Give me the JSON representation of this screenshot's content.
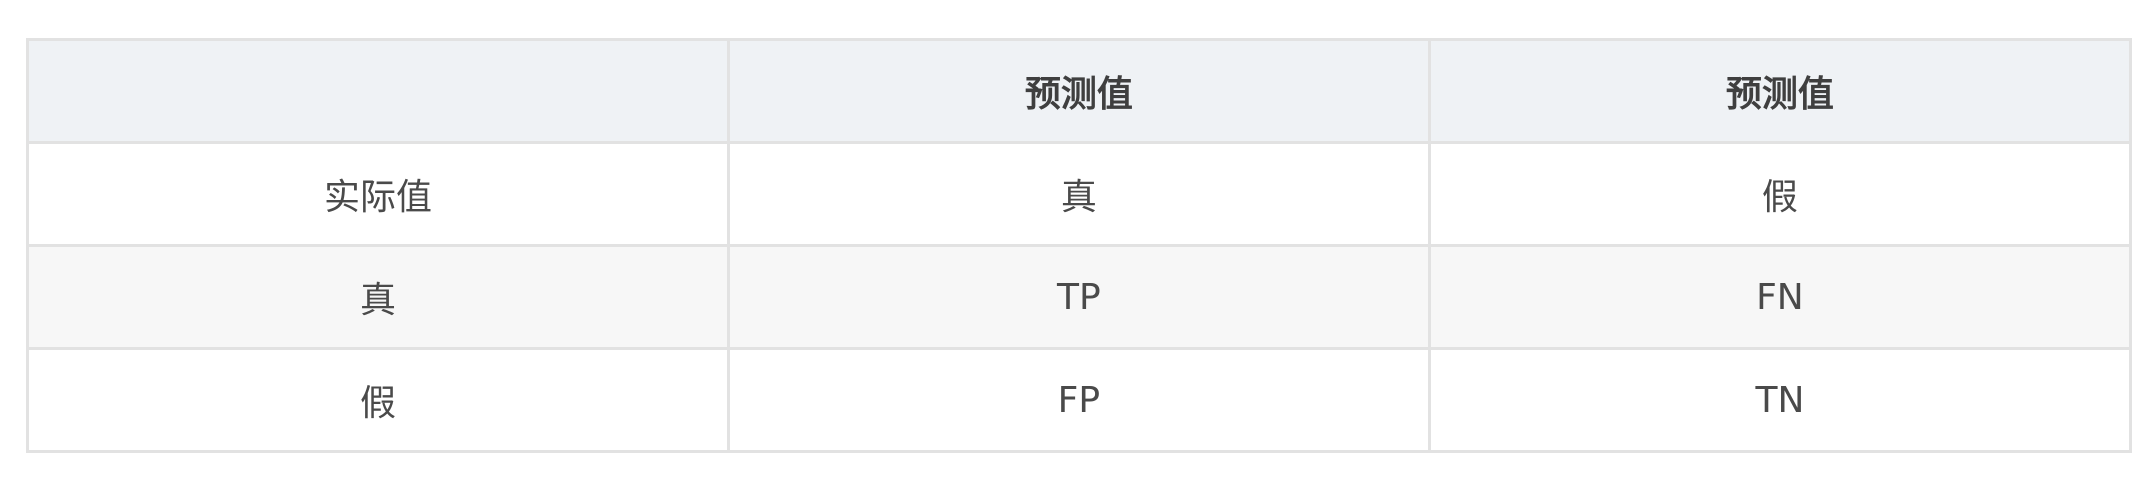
{
  "table": {
    "headers": [
      "",
      "预测值",
      "预测值"
    ],
    "rows": [
      [
        "实际值",
        "真",
        "假"
      ],
      [
        "真",
        "TP",
        "FN"
      ],
      [
        "假",
        "FP",
        "TN"
      ]
    ]
  }
}
